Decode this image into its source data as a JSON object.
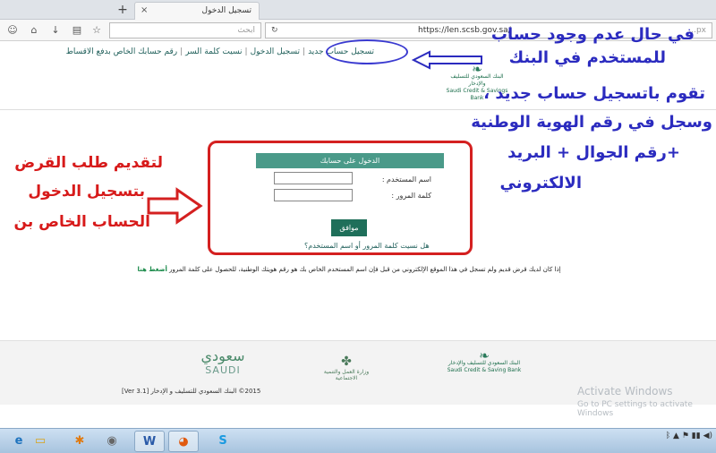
{
  "browser": {
    "tab_title": "تسجيل الدخول",
    "tab_close": "×",
    "new_tab": "+",
    "search_placeholder": "ابحث",
    "url": "https://len.scsb.gov.sa/",
    "url_rest": "...px"
  },
  "header": {
    "links": [
      "تسجيل حساب جديد",
      "تسجيل الدخول",
      "نسيت كلمة السر",
      "رقم حسابك الخاص بدفع الاقساط"
    ],
    "bank_name_ar": "البنك السعودي للتسليف والإدخار",
    "bank_name_en": "Saudi Credit & Savings Bank"
  },
  "annotations": {
    "blue_1": "في حال عدم وجود حساب",
    "blue_2": "للمستخدم في البنك",
    "blue_3": "تقوم باتسجيل حساب جديد ،",
    "blue_4": "وسجل في رقم الهوية الوطنية",
    "blue_5": "+رقم الجوال + البريد",
    "blue_6": "الالكتروني",
    "red_1": "لتقديم طلب القرض",
    "red_2": "بتسجيل الدخول",
    "red_3": "الحساب الخاص بن"
  },
  "login": {
    "header": "الدخول على حسابك",
    "username_label": "اسم المستخدم :",
    "password_label": "كلمة المرور :",
    "username_value": "",
    "password_value": "",
    "submit_label": "موافق",
    "forgot_link": "هل نسيت كلمة المرور أو اسم المستخدم؟"
  },
  "info": {
    "text": "إذا كان لديك قرض قديم ولم تسجل في هذا الموقع الإلكتروني من قبل فإن اسم المستخدم الخاص بك هو رقم هويتك الوطنية، للحصول على كلمة المرور",
    "link": "أضغط هنا"
  },
  "footer": {
    "saudi_ar": "سعودي",
    "saudi_en": "SAUDI",
    "ministry": "وزارة العمل والتنمية الاجتماعية",
    "bank_ar": "البنك السعودي للتسليف والإدخار",
    "bank_en": "Saudi Credit & Saving Bank",
    "copyright": "2015© البنك السعودي للتسليف و الإدخار [Ver 3.1]"
  },
  "watermark": {
    "line1": "Activate Windows",
    "line2": "Go to PC settings to activate Windows"
  },
  "taskbar": {
    "apps": [
      "ie-icon",
      "explorer-icon",
      "media-icon",
      "chrome-icon",
      "word-icon",
      "firefox-icon",
      "skype-icon"
    ],
    "word_label": "W",
    "skype_label": "S"
  },
  "colors": {
    "accent_green": "#4a9a89",
    "button_green": "#1f6f5a",
    "annotation_red": "#d42020",
    "annotation_blue": "#2b2bbf"
  }
}
